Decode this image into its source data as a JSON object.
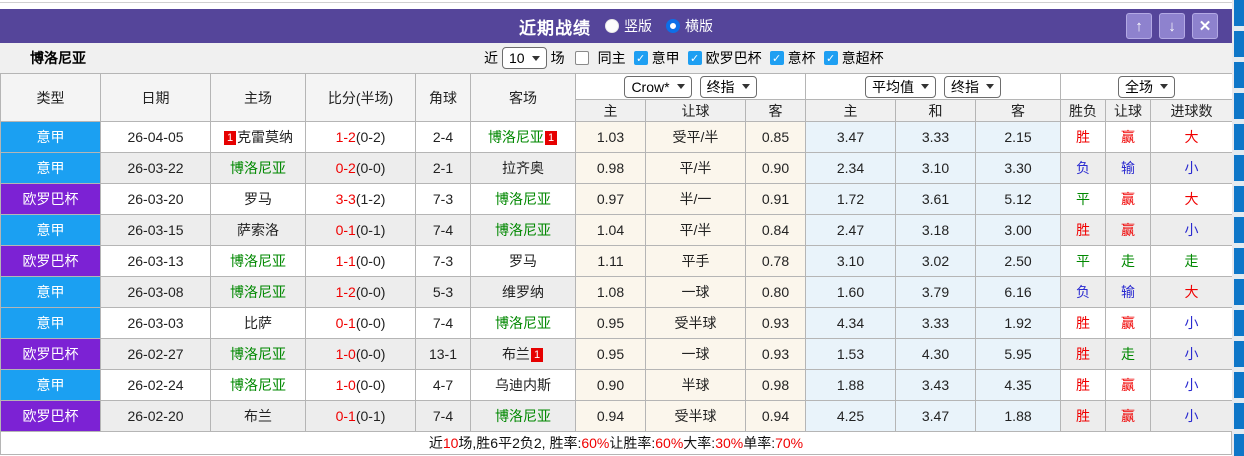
{
  "icons": {
    "up_arrow": "↑",
    "down_arrow": "↓",
    "close": "✕",
    "check": "✓"
  },
  "titlebar": {
    "title": "近期战绩",
    "vertical_label": "竖版",
    "horizontal_label": "横版",
    "bg_color": "#55459a"
  },
  "filter": {
    "team": "博洛尼亚",
    "near_label": "近",
    "count_value": "10",
    "games_label": "场",
    "same_home_label": "同主",
    "leagues": [
      {
        "label": "意甲",
        "checked": true
      },
      {
        "label": "欧罗巴杯",
        "checked": true
      },
      {
        "label": "意杯",
        "checked": true
      },
      {
        "label": "意超杯",
        "checked": true
      }
    ]
  },
  "header": {
    "static": [
      "类型",
      "日期",
      "主场",
      "比分(半场)",
      "角球",
      "客场"
    ],
    "book_select": "Crow*",
    "book_ref_select": "终指",
    "avg_select": "平均值",
    "avg_ref_select": "终指",
    "scope_select": "全场",
    "odds1_cols": [
      "主",
      "让球",
      "客"
    ],
    "odds2_cols": [
      "主",
      "和",
      "客"
    ],
    "result_cols": [
      "胜负",
      "让球",
      "进球数"
    ]
  },
  "table": {
    "league_colors": {
      "意甲": "#1ba0f2",
      "欧罗巴杯": "#7c22d4"
    },
    "outcome_colors": {
      "red": "#f00000",
      "blue": "#2a2ad0",
      "green": "#008800"
    },
    "rows": [
      {
        "league": "意甲",
        "date": "26-04-05",
        "home": {
          "name": "克雷莫纳",
          "green": false,
          "badge": "1",
          "badge_pos": "left"
        },
        "score": "1-2",
        "half": "(0-2)",
        "corner": "2-4",
        "away": {
          "name": "博洛尼亚",
          "green": true,
          "badge": "1",
          "badge_pos": "right"
        },
        "crow": [
          "1.03",
          "受平/半",
          "0.85"
        ],
        "avg": [
          "3.47",
          "3.33",
          "2.15"
        ],
        "outcome": [
          [
            "胜",
            "red"
          ],
          [
            "赢",
            "red"
          ],
          [
            "大",
            "red"
          ]
        ]
      },
      {
        "league": "意甲",
        "date": "26-03-22",
        "home": {
          "name": "博洛尼亚",
          "green": true
        },
        "score": "0-2",
        "half": "(0-0)",
        "corner": "2-1",
        "away": {
          "name": "拉齐奥",
          "green": false
        },
        "crow": [
          "0.98",
          "平/半",
          "0.90"
        ],
        "avg": [
          "2.34",
          "3.10",
          "3.30"
        ],
        "outcome": [
          [
            "负",
            "blue"
          ],
          [
            "输",
            "blue"
          ],
          [
            "小",
            "blue"
          ]
        ]
      },
      {
        "league": "欧罗巴杯",
        "date": "26-03-20",
        "home": {
          "name": "罗马",
          "green": false
        },
        "score": "3-3",
        "half": "(1-2)",
        "corner": "7-3",
        "away": {
          "name": "博洛尼亚",
          "green": true
        },
        "crow": [
          "0.97",
          "半/一",
          "0.91"
        ],
        "avg": [
          "1.72",
          "3.61",
          "5.12"
        ],
        "outcome": [
          [
            "平",
            "green"
          ],
          [
            "赢",
            "red"
          ],
          [
            "大",
            "red"
          ]
        ]
      },
      {
        "league": "意甲",
        "date": "26-03-15",
        "home": {
          "name": "萨索洛",
          "green": false
        },
        "score": "0-1",
        "half": "(0-1)",
        "corner": "7-4",
        "away": {
          "name": "博洛尼亚",
          "green": true
        },
        "crow": [
          "1.04",
          "平/半",
          "0.84"
        ],
        "avg": [
          "2.47",
          "3.18",
          "3.00"
        ],
        "outcome": [
          [
            "胜",
            "red"
          ],
          [
            "赢",
            "red"
          ],
          [
            "小",
            "blue"
          ]
        ]
      },
      {
        "league": "欧罗巴杯",
        "date": "26-03-13",
        "home": {
          "name": "博洛尼亚",
          "green": true
        },
        "score": "1-1",
        "half": "(0-0)",
        "corner": "7-3",
        "away": {
          "name": "罗马",
          "green": false
        },
        "crow": [
          "1.11",
          "平手",
          "0.78"
        ],
        "avg": [
          "3.10",
          "3.02",
          "2.50"
        ],
        "outcome": [
          [
            "平",
            "green"
          ],
          [
            "走",
            "green"
          ],
          [
            "走",
            "green"
          ]
        ]
      },
      {
        "league": "意甲",
        "date": "26-03-08",
        "home": {
          "name": "博洛尼亚",
          "green": true
        },
        "score": "1-2",
        "half": "(0-0)",
        "corner": "5-3",
        "away": {
          "name": "维罗纳",
          "green": false
        },
        "crow": [
          "1.08",
          "一球",
          "0.80"
        ],
        "avg": [
          "1.60",
          "3.79",
          "6.16"
        ],
        "outcome": [
          [
            "负",
            "blue"
          ],
          [
            "输",
            "blue"
          ],
          [
            "大",
            "red"
          ]
        ]
      },
      {
        "league": "意甲",
        "date": "26-03-03",
        "home": {
          "name": "比萨",
          "green": false
        },
        "score": "0-1",
        "half": "(0-0)",
        "corner": "7-4",
        "away": {
          "name": "博洛尼亚",
          "green": true
        },
        "crow": [
          "0.95",
          "受半球",
          "0.93"
        ],
        "avg": [
          "4.34",
          "3.33",
          "1.92"
        ],
        "outcome": [
          [
            "胜",
            "red"
          ],
          [
            "赢",
            "red"
          ],
          [
            "小",
            "blue"
          ]
        ]
      },
      {
        "league": "欧罗巴杯",
        "date": "26-02-27",
        "home": {
          "name": "博洛尼亚",
          "green": true
        },
        "score": "1-0",
        "half": "(0-0)",
        "corner": "13-1",
        "away": {
          "name": "布兰",
          "green": false,
          "badge": "1",
          "badge_pos": "right"
        },
        "crow": [
          "0.95",
          "一球",
          "0.93"
        ],
        "avg": [
          "1.53",
          "4.30",
          "5.95"
        ],
        "outcome": [
          [
            "胜",
            "red"
          ],
          [
            "走",
            "green"
          ],
          [
            "小",
            "blue"
          ]
        ]
      },
      {
        "league": "意甲",
        "date": "26-02-24",
        "home": {
          "name": "博洛尼亚",
          "green": true
        },
        "score": "1-0",
        "half": "(0-0)",
        "corner": "4-7",
        "away": {
          "name": "乌迪内斯",
          "green": false
        },
        "crow": [
          "0.90",
          "半球",
          "0.98"
        ],
        "avg": [
          "1.88",
          "3.43",
          "4.35"
        ],
        "outcome": [
          [
            "胜",
            "red"
          ],
          [
            "赢",
            "red"
          ],
          [
            "小",
            "blue"
          ]
        ]
      },
      {
        "league": "欧罗巴杯",
        "date": "26-02-20",
        "home": {
          "name": "布兰",
          "green": false
        },
        "score": "0-1",
        "half": "(0-1)",
        "corner": "7-4",
        "away": {
          "name": "博洛尼亚",
          "green": true
        },
        "crow": [
          "0.94",
          "受半球",
          "0.94"
        ],
        "avg": [
          "4.25",
          "3.47",
          "1.88"
        ],
        "outcome": [
          [
            "胜",
            "red"
          ],
          [
            "赢",
            "red"
          ],
          [
            "小",
            "blue"
          ]
        ]
      }
    ]
  },
  "summary": {
    "parts": [
      {
        "t": "近",
        "red": false
      },
      {
        "t": "10",
        "red": true
      },
      {
        "t": "场,胜6平2负2, 胜率:",
        "red": false
      },
      {
        "t": "60%",
        "red": true
      },
      {
        "t": " 让胜率:",
        "red": false
      },
      {
        "t": "60%",
        "red": true
      },
      {
        "t": " 大率:",
        "red": false
      },
      {
        "t": "30%",
        "red": true
      },
      {
        "t": " 单率:",
        "red": false
      },
      {
        "t": "70%",
        "red": true
      }
    ]
  }
}
